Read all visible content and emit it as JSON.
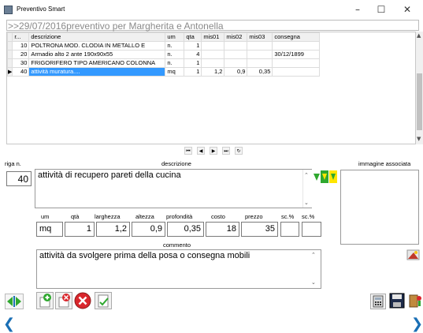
{
  "window": {
    "title": "Preventivo Smart",
    "controls": {
      "minimize": "–",
      "maximize": "☐",
      "close": "✕"
    }
  },
  "header": {
    "text": ">>29/07/2016preventivo per Margherita e Antonella"
  },
  "grid": {
    "columns": [
      "r...",
      "descrizione",
      "um",
      "qta",
      "mis01",
      "mis02",
      "mis03",
      "consegna"
    ],
    "rows": [
      {
        "r": "10",
        "descrizione": "POLTRONA MOD. CLODIA IN METALLO E",
        "um": "n.",
        "qta": "1",
        "mis01": "",
        "mis02": "",
        "mis03": "",
        "consegna": ""
      },
      {
        "r": "20",
        "descrizione": "Armadio alto 2 ante 190x90x55",
        "um": "n.",
        "qta": "4",
        "mis01": "",
        "mis02": "",
        "mis03": "",
        "consegna": "30/12/1899"
      },
      {
        "r": "30",
        "descrizione": "FRIGORIFERO TIPO AMERICANO COLONNA",
        "um": "n.",
        "qta": "1",
        "mis01": "",
        "mis02": "",
        "mis03": "",
        "consegna": ""
      },
      {
        "r": "40",
        "descrizione": "attività muratura....",
        "um": "mq",
        "qta": "1",
        "mis01": "1,2",
        "mis02": "0,9",
        "mis03": "0,35",
        "consegna": ""
      }
    ],
    "selected_row": 3
  },
  "navigator": {
    "first": "⏮",
    "prev": "◀",
    "next": "▶",
    "last": "⏭",
    "refresh": "↻"
  },
  "form": {
    "riga_label": "riga n.",
    "riga_value": "40",
    "descrizione_label": "descrizione",
    "descrizione_value": "attività di recupero pareti della cucina",
    "immagine_label": "immagine associata",
    "labels": {
      "um": "um",
      "qta": "qtà",
      "larghezza": "larghezza",
      "altezza": "altezza",
      "profondita": "profondità",
      "costo": "costo",
      "prezzo": "prezzo",
      "sc1": "sc.%",
      "sc2": "sc.%",
      "commento": "commento"
    },
    "values": {
      "um": "mq",
      "qta": "1",
      "larghezza": "1,2",
      "altezza": "0,9",
      "profondita": "0,35",
      "costo": "18",
      "prezzo": "35",
      "sc1": "",
      "sc2": ""
    },
    "commento_value": "attività da svolgere prima della posa o consegna mobili"
  },
  "colors": {
    "selection": "#3399ff",
    "chevron": "#1a6fb5",
    "green": "#2fa82f",
    "yellow": "#ffe600",
    "red": "#d9262c"
  }
}
